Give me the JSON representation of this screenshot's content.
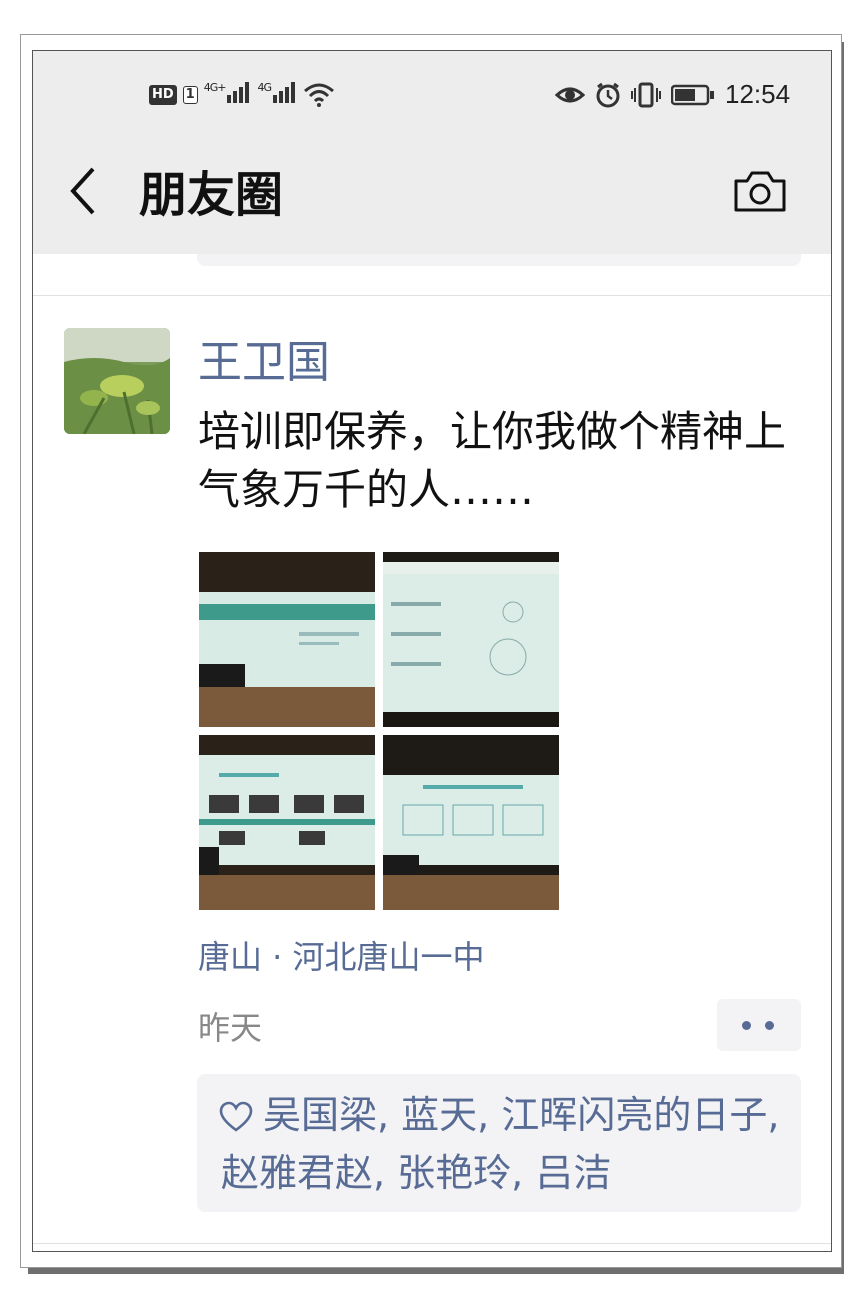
{
  "status_bar": {
    "hd": "HD",
    "sim": "1",
    "net1": "4G+",
    "net2": "4G",
    "time": "12:54"
  },
  "header": {
    "back_icon": "chevron-left-icon",
    "title": "朋友圈",
    "camera_icon": "camera-icon"
  },
  "post": {
    "author": "王卫国",
    "text": "培训即保养，让你我做个精神上气象万千的人……",
    "photos": [
      "photo-1",
      "photo-2",
      "photo-3",
      "photo-4"
    ],
    "location": "唐山 · 河北唐山一中",
    "time": "昨天",
    "likes": "吴国梁, 蓝天, 江晖闪亮的日子, 赵雅君赵, 张艳玲, 吕洁"
  },
  "colors": {
    "link": "#576b95",
    "header_bg": "#ededed",
    "comment_bg": "#f3f3f5"
  }
}
